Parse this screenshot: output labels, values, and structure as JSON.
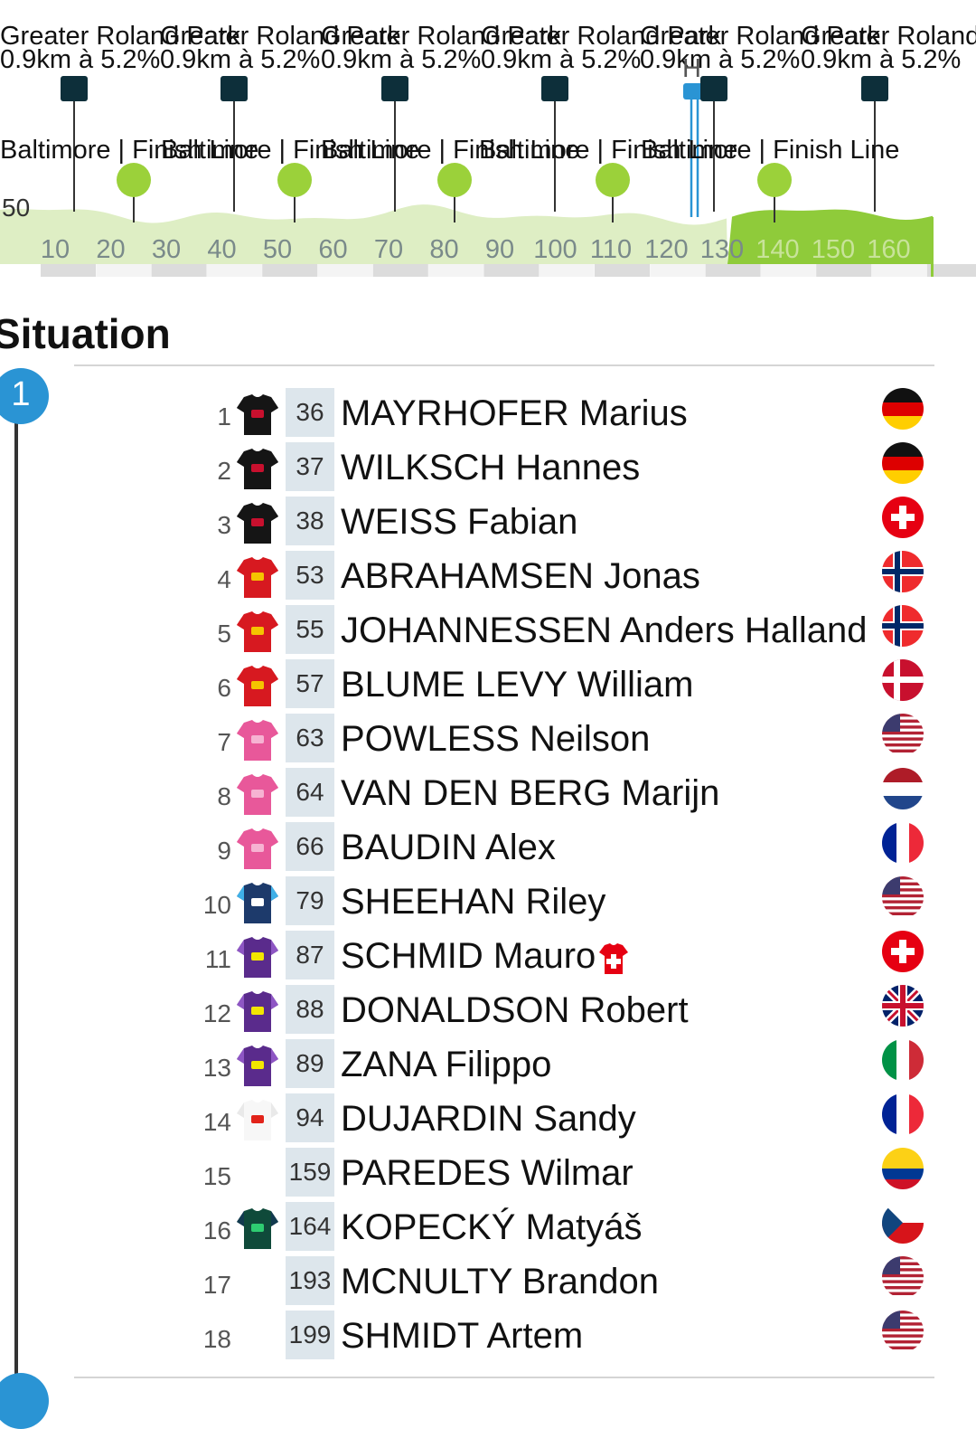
{
  "profile": {
    "climb_name": "Greater Roland Park",
    "climb_stats": "0.9km à 5.2%",
    "sprint_name": "Baltimore | Finish Line",
    "altitude_label": "50",
    "km_ticks": [
      "10",
      "20",
      "30",
      "40",
      "50",
      "60",
      "70",
      "80",
      "90",
      "100",
      "110",
      "120",
      "130",
      "140",
      "150",
      "160"
    ],
    "position_marker_label": "H",
    "progress_fraction": 0.77
  },
  "situation": {
    "title": "Situation",
    "group_number": "1",
    "riders": [
      {
        "rank": "1",
        "bib": "36",
        "name": "MAYRHOFER Marius",
        "team": "tudor",
        "flag": "de"
      },
      {
        "rank": "2",
        "bib": "37",
        "name": "WILKSCH Hannes",
        "team": "tudor",
        "flag": "de"
      },
      {
        "rank": "3",
        "bib": "38",
        "name": "WEISS Fabian",
        "team": "tudor",
        "flag": "ch"
      },
      {
        "rank": "4",
        "bib": "53",
        "name": "ABRAHAMSEN Jonas",
        "team": "unox",
        "flag": "no"
      },
      {
        "rank": "5",
        "bib": "55",
        "name": "JOHANNESSEN Anders Halland",
        "team": "unox",
        "flag": "no"
      },
      {
        "rank": "6",
        "bib": "57",
        "name": "BLUME LEVY William",
        "team": "unox",
        "flag": "dk"
      },
      {
        "rank": "7",
        "bib": "63",
        "name": "POWLESS Neilson",
        "team": "ef",
        "flag": "us"
      },
      {
        "rank": "8",
        "bib": "64",
        "name": "VAN DEN BERG Marijn",
        "team": "ef",
        "flag": "nl"
      },
      {
        "rank": "9",
        "bib": "66",
        "name": "BAUDIN Alex",
        "team": "ef",
        "flag": "fr"
      },
      {
        "rank": "10",
        "bib": "79",
        "name": "SHEEHAN Riley",
        "team": "israel",
        "flag": "us"
      },
      {
        "rank": "11",
        "bib": "87",
        "name": "SCHMID Mauro",
        "team": "jayco",
        "flag": "ch",
        "champion": true
      },
      {
        "rank": "12",
        "bib": "88",
        "name": "DONALDSON Robert",
        "team": "jayco",
        "flag": "gb"
      },
      {
        "rank": "13",
        "bib": "89",
        "name": "ZANA Filippo",
        "team": "jayco",
        "flag": "it"
      },
      {
        "rank": "14",
        "bib": "94",
        "name": "DUJARDIN Sandy",
        "team": "total",
        "flag": "fr"
      },
      {
        "rank": "15",
        "bib": "159",
        "name": "PAREDES Wilmar",
        "team": "none",
        "flag": "co"
      },
      {
        "rank": "16",
        "bib": "164",
        "name": "KOPECKÝ Matyáš",
        "team": "visma",
        "flag": "cz"
      },
      {
        "rank": "17",
        "bib": "193",
        "name": "MCNULTY Brandon",
        "team": "none",
        "flag": "us"
      },
      {
        "rank": "18",
        "bib": "199",
        "name": "SHMIDT Artem",
        "team": "none",
        "flag": "us"
      }
    ]
  },
  "colors": {
    "profile_light": "#deeec4",
    "profile_done": "#8fcb3a",
    "climb_marker": "#0d2f3a",
    "sprint_marker": "#9bd13a",
    "badge": "#2a94d4",
    "bib_bg": "#dde6ec"
  }
}
